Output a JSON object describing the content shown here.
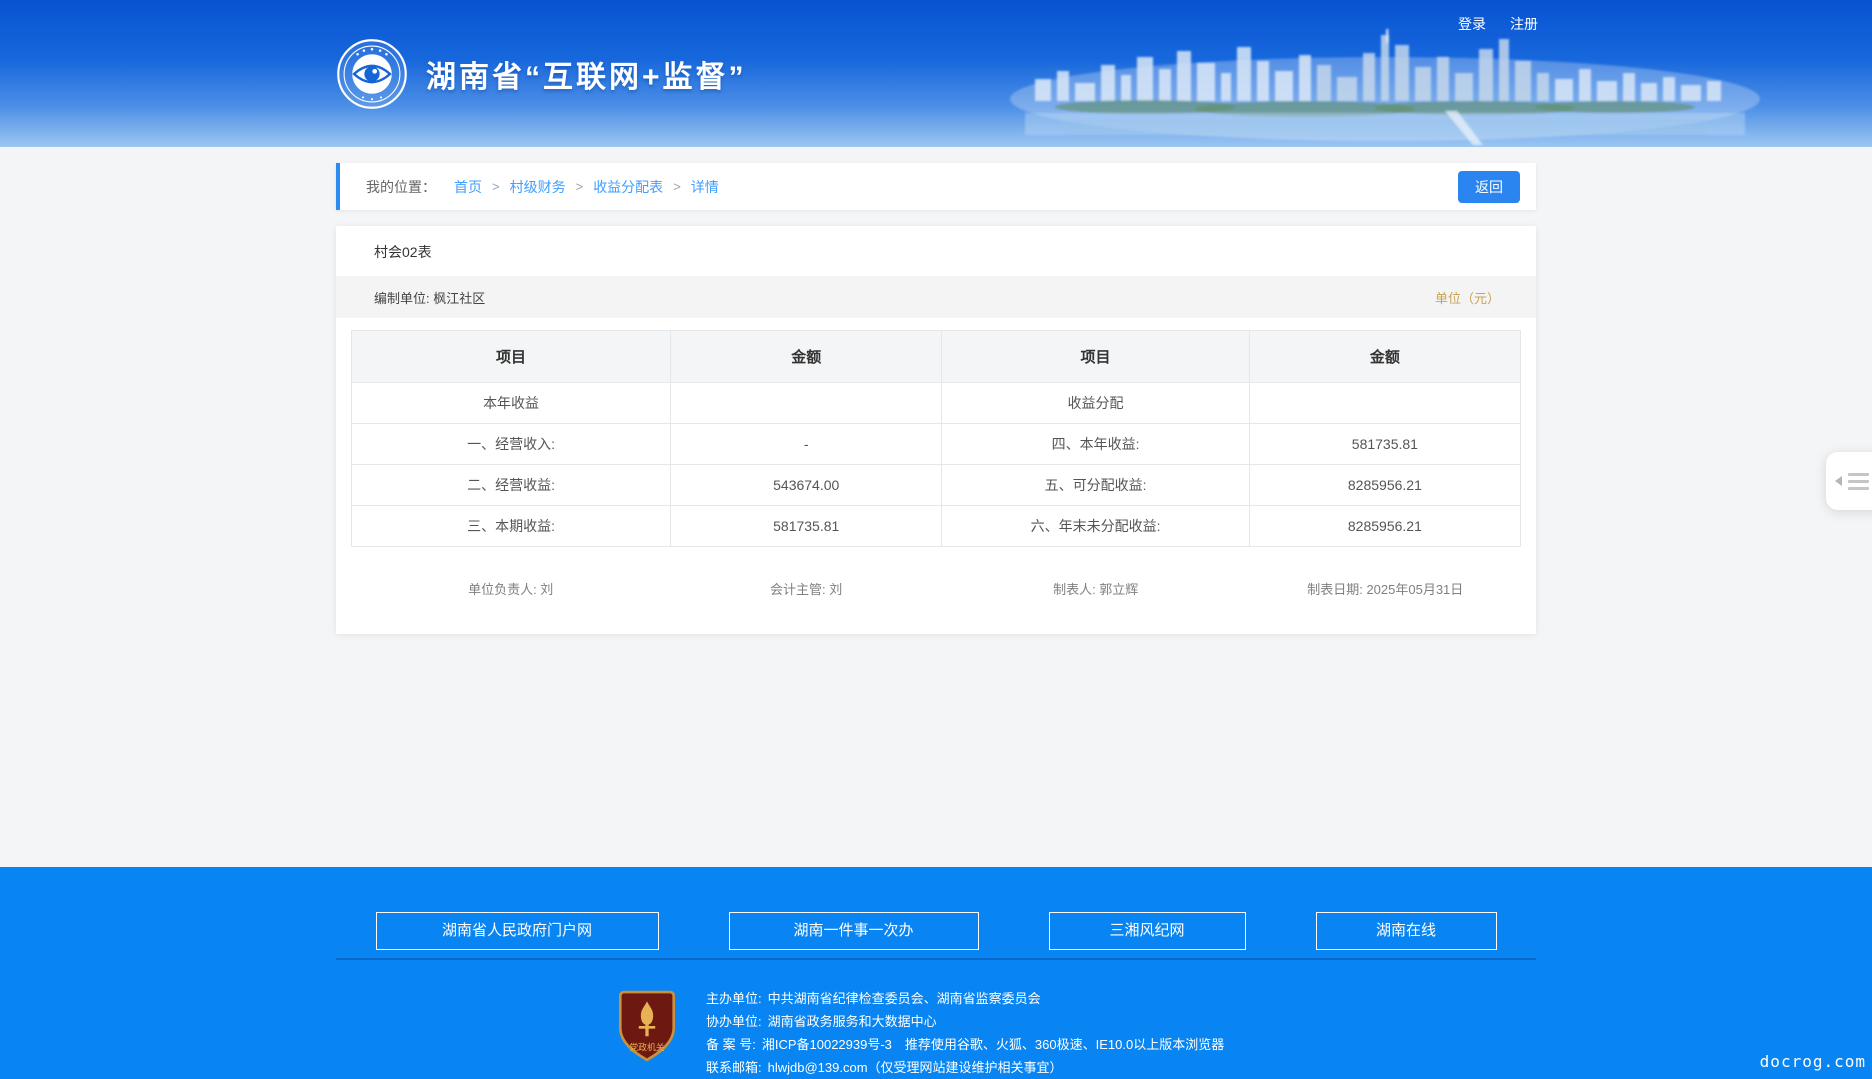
{
  "header": {
    "title": "湖南省“互联网+监督”",
    "login": "登录",
    "register": "注册"
  },
  "breadcrumb": {
    "label": "我的位置：",
    "separator": ">",
    "items": [
      "首页",
      "村级财务",
      "收益分配表",
      "详情"
    ],
    "back": "返回"
  },
  "report": {
    "title": "村会02表",
    "unit": "编制单位: 枫江社区",
    "currency": "单位（元）",
    "table": {
      "headers": [
        "项目",
        "金额",
        "项目",
        "金额"
      ],
      "rows": [
        [
          "本年收益",
          "",
          "收益分配",
          ""
        ],
        [
          "一、经营收入:",
          "-",
          "四、本年收益:",
          "581735.81"
        ],
        [
          "二、经营收益:",
          "543674.00",
          "五、可分配收益:",
          "8285956.21"
        ],
        [
          "三、本期收益:",
          "581735.81",
          "六、年末未分配收益:",
          "8285956.21"
        ]
      ]
    },
    "signers": [
      "单位负责人: 刘",
      "会计主管: 刘",
      "制表人: 郭立辉",
      "制表日期: 2025年05月31日"
    ]
  },
  "footer": {
    "links": [
      "湖南省人民政府门户网",
      "湖南一件事一次办",
      "三湘风纪网",
      "湖南在线"
    ],
    "info": [
      {
        "label": "主办单位:",
        "value": "中共湖南省纪律检查委员会、湖南省监察委员会"
      },
      {
        "label": "协办单位:",
        "value": "湖南省政务服务和大数据中心"
      },
      {
        "label": "备 案 号:",
        "value": "湘ICP备10022939号-3　推荐使用谷歌、火狐、360极速、IE10.0以上版本浏览器"
      },
      {
        "label": "联系邮箱:",
        "value": "hlwjdb@139.com（仅受理网站建设维护相关事宜）"
      }
    ],
    "badge": "党政机关",
    "watermark": "docrog.com"
  },
  "colors": {
    "accent_blue": "#409eff",
    "value_blue": "#3e8df7",
    "footer_blue": "#0885f2",
    "currency_orange": "#c9a353",
    "header_gradient_top": "#0753d2"
  }
}
